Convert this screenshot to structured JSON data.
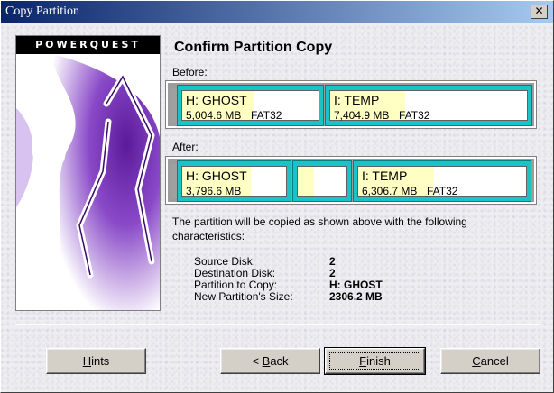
{
  "window": {
    "title": "Copy Partition",
    "close_glyph": "✕"
  },
  "logo": {
    "brand": "POWERQUEST"
  },
  "heading": "Confirm Partition Copy",
  "before": {
    "label": "Before:",
    "partitions": [
      {
        "name": "H:  GHOST",
        "size": "5,004.6 MB",
        "fs": "FAT32"
      },
      {
        "name": "I:  TEMP",
        "size": "7,404.9 MB",
        "fs": "FAT32"
      }
    ]
  },
  "after": {
    "label": "After:",
    "partitions": [
      {
        "name": "H:  GHOST",
        "size": "3,796.6 MB",
        "fs": ""
      },
      {
        "name": "I:  TEMP",
        "size": "6,306.7 MB",
        "fs": "FAT32"
      }
    ]
  },
  "description": "The partition will be copied as shown above with the following characteristics:",
  "details": [
    {
      "key": "Source Disk:",
      "value": "2"
    },
    {
      "key": "Destination Disk:",
      "value": "2"
    },
    {
      "key": "Partition to Copy:",
      "value": "H: GHOST"
    },
    {
      "key": "New Partition's Size:",
      "value": "2306.2 MB"
    }
  ],
  "buttons": {
    "hints": {
      "mnemonic": "H",
      "rest": "ints"
    },
    "back": {
      "prefix": "< ",
      "mnemonic": "B",
      "rest": "ack"
    },
    "finish": {
      "mnemonic": "F",
      "rest": "inish"
    },
    "cancel": {
      "mnemonic": "C",
      "rest": "ancel"
    }
  },
  "colors": {
    "titlebar_start": "#0a246a",
    "partition_border": "#1ac4c4",
    "used_space": "#ffffc4"
  }
}
